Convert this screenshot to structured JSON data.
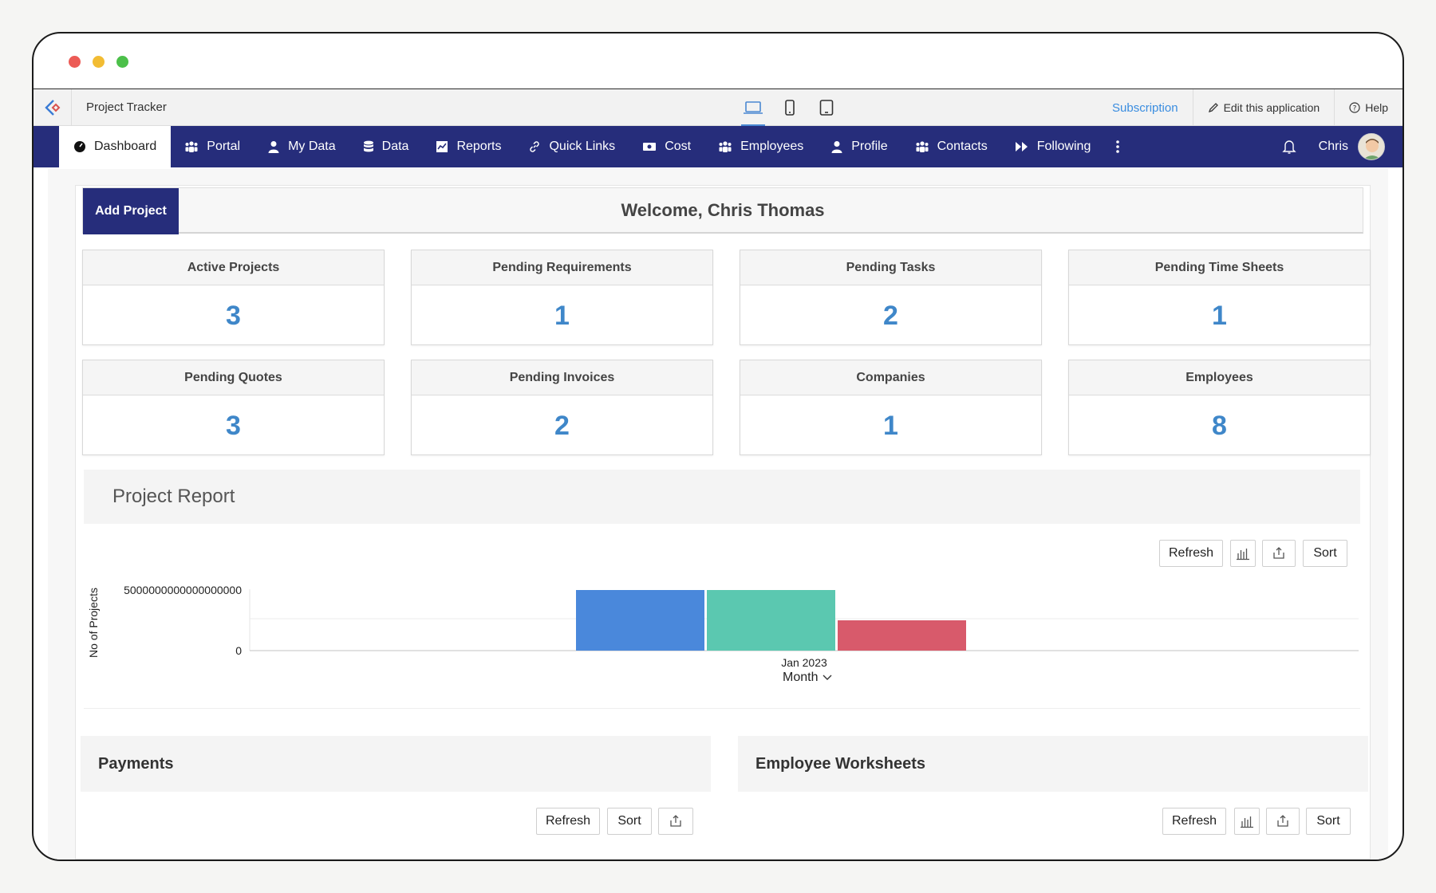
{
  "app": {
    "title": "Project Tracker"
  },
  "appbar": {
    "subscription": "Subscription",
    "edit": "Edit this application",
    "help": "Help"
  },
  "nav": {
    "items": [
      {
        "label": "Dashboard",
        "icon": "dashboard-icon"
      },
      {
        "label": "Portal",
        "icon": "group-icon"
      },
      {
        "label": "My Data",
        "icon": "user-icon"
      },
      {
        "label": "Data",
        "icon": "database-icon"
      },
      {
        "label": "Reports",
        "icon": "chart-icon"
      },
      {
        "label": "Quick Links",
        "icon": "link-icon"
      },
      {
        "label": "Cost",
        "icon": "money-icon"
      },
      {
        "label": "Employees",
        "icon": "group-icon"
      },
      {
        "label": "Profile",
        "icon": "user-icon"
      },
      {
        "label": "Contacts",
        "icon": "group-icon"
      },
      {
        "label": "Following",
        "icon": "fast-forward-icon"
      }
    ],
    "user": "Chris"
  },
  "dashboard": {
    "add_project": "Add Project",
    "welcome": "Welcome, Chris Thomas",
    "stats": [
      {
        "label": "Active Projects",
        "value": "3"
      },
      {
        "label": "Pending Requirements",
        "value": "1"
      },
      {
        "label": "Pending Tasks",
        "value": "2"
      },
      {
        "label": "Pending Time Sheets",
        "value": "1"
      },
      {
        "label": "Pending Quotes",
        "value": "3"
      },
      {
        "label": "Pending Invoices",
        "value": "2"
      },
      {
        "label": "Companies",
        "value": "1"
      },
      {
        "label": "Employees",
        "value": "8"
      }
    ]
  },
  "report": {
    "title": "Project Report",
    "refresh": "Refresh",
    "sort": "Sort",
    "group_by": "Month"
  },
  "chart_data": {
    "type": "bar",
    "categories": [
      "Jan 2023"
    ],
    "series": [
      {
        "values": [
          5000000000000000000
        ],
        "color": "#4a88db"
      },
      {
        "values": [
          5000000000000000000
        ],
        "color": "#5bc8b0"
      },
      {
        "values": [
          2500000000000000000
        ],
        "color": "#d85a6b"
      }
    ],
    "ylabel": "No of Projects",
    "yticks": [
      "0",
      "5000000000000000000"
    ],
    "ylim": [
      0,
      5000000000000000000
    ],
    "grid": true
  },
  "payments": {
    "title": "Payments",
    "refresh": "Refresh",
    "sort": "Sort"
  },
  "worksheets": {
    "title": "Employee Worksheets",
    "refresh": "Refresh",
    "sort": "Sort"
  }
}
